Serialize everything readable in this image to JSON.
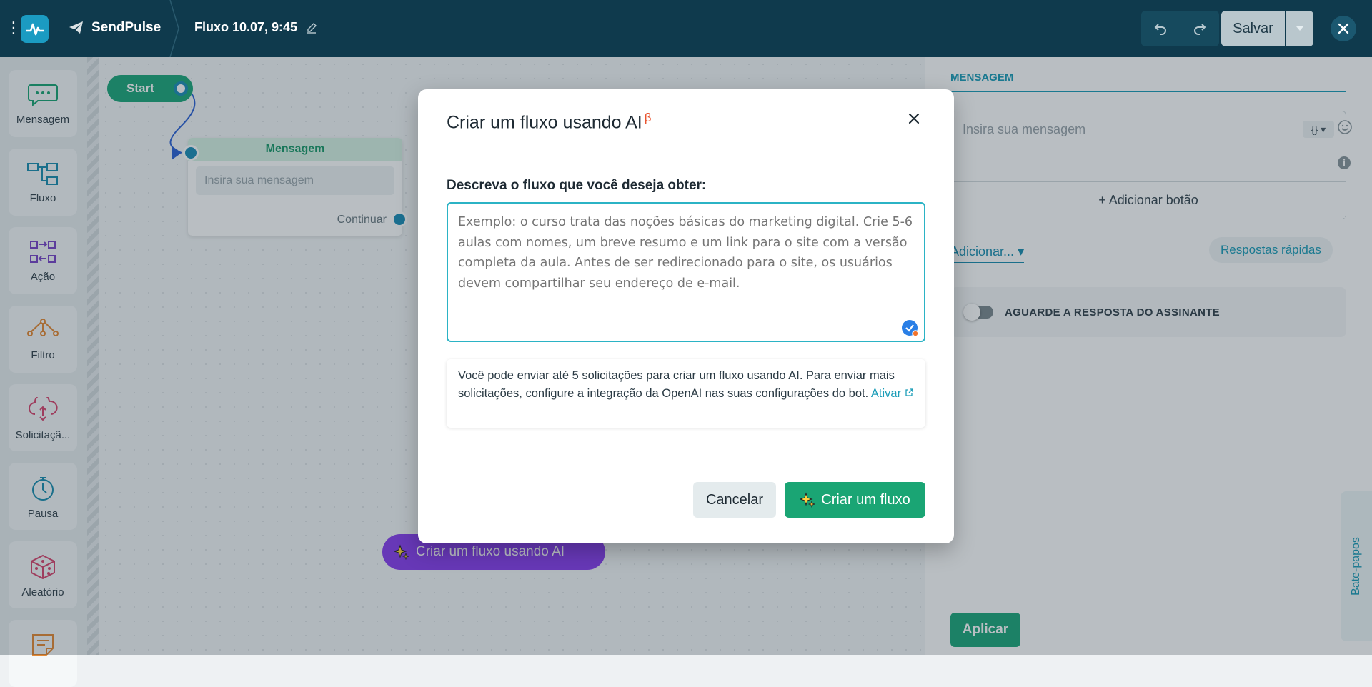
{
  "topbar": {
    "brand": "SendPulse",
    "flow_title": "Fluxo 10.07, 9:45",
    "save_label": "Salvar"
  },
  "tools": [
    {
      "label": "Mensagem",
      "icon": "chat-bubble-icon"
    },
    {
      "label": "Fluxo",
      "icon": "flow-icon"
    },
    {
      "label": "Ação",
      "icon": "action-icon"
    },
    {
      "label": "Filtro",
      "icon": "filter-icon"
    },
    {
      "label": "Solicitaçã...",
      "icon": "request-cloud-icon"
    },
    {
      "label": "Pausa",
      "icon": "stopwatch-icon"
    },
    {
      "label": "Aleatório",
      "icon": "dice-icon"
    }
  ],
  "canvas": {
    "start_label": "Start",
    "node_title": "Mensagem",
    "node_placeholder": "Insira sua mensagem",
    "node_continue": "Continuar",
    "ai_button": "Criar um fluxo usando AI"
  },
  "panel": {
    "tab": "MENSAGEM",
    "message_placeholder": "Insira sua mensagem",
    "vars_label": "{}",
    "add_button": "+ Adicionar botão",
    "add_menu": "Adicionar...",
    "quick_replies": "Respostas rápidas",
    "wait_label": "AGUARDE A RESPOSTA DO ASSINANTE",
    "chats_tab": "Bate-papos",
    "apply": "Aplicar"
  },
  "modal": {
    "title": "Criar um fluxo usando AI",
    "beta": "β",
    "label": "Descreva o fluxo que você deseja obter:",
    "placeholder": "Exemplo: o curso trata das noções básicas do marketing digital. Crie 5-6 aulas com nomes, um breve resumo e um link para o site com a versão completa da aula. Antes de ser redirecionado para o site, os usuários devem compartilhar seu endereço de e-mail.",
    "note": "Você pode enviar até 5 solicitações para criar um fluxo usando AI. Para enviar mais solicitações, configure a integração da OpenAI nas suas configurações do bot.",
    "note_link": "Ativar",
    "cancel": "Cancelar",
    "create": "Criar um fluxo"
  },
  "colors": {
    "topbar": "#0f3a4d",
    "accent_green": "#1aa574",
    "accent_teal": "#1c9db8",
    "ai_purple": "#8a3ff0"
  }
}
